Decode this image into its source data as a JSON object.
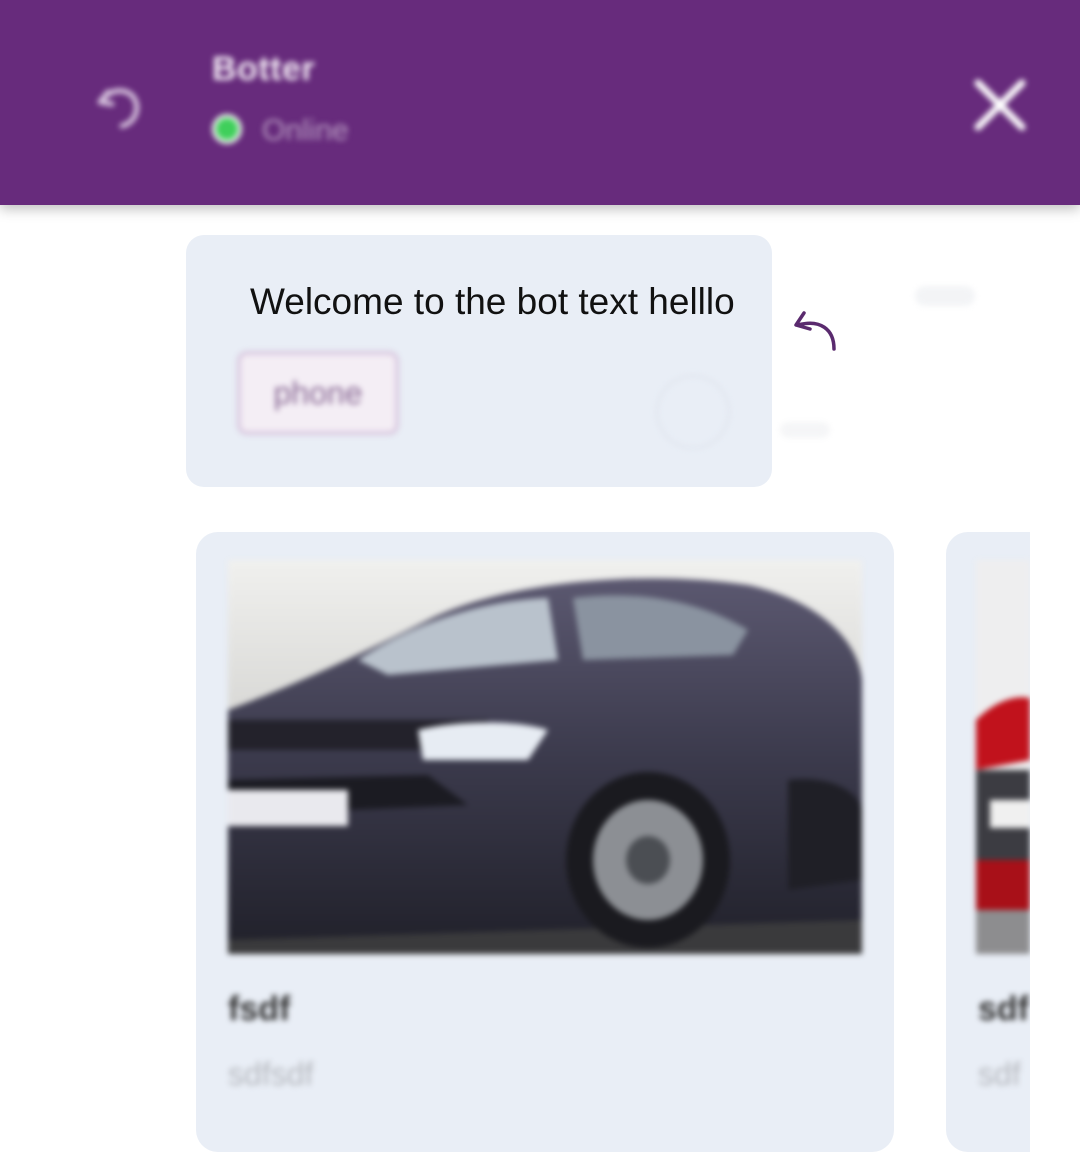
{
  "header": {
    "title": "Botter",
    "status": "Online",
    "colors": {
      "background": "#672b7c",
      "status_dot": "#3fcf5b"
    },
    "icons": {
      "left": "undo-icon",
      "right": "close-icon"
    }
  },
  "message": {
    "text": "Welcome to the bot text helllo",
    "button_label": "phone",
    "reply_icon": "reply-arrow-icon"
  },
  "cards": [
    {
      "title": "fsdf",
      "subtitle": "sdfsdf"
    },
    {
      "title": "sdf",
      "subtitle": "sdf"
    }
  ]
}
